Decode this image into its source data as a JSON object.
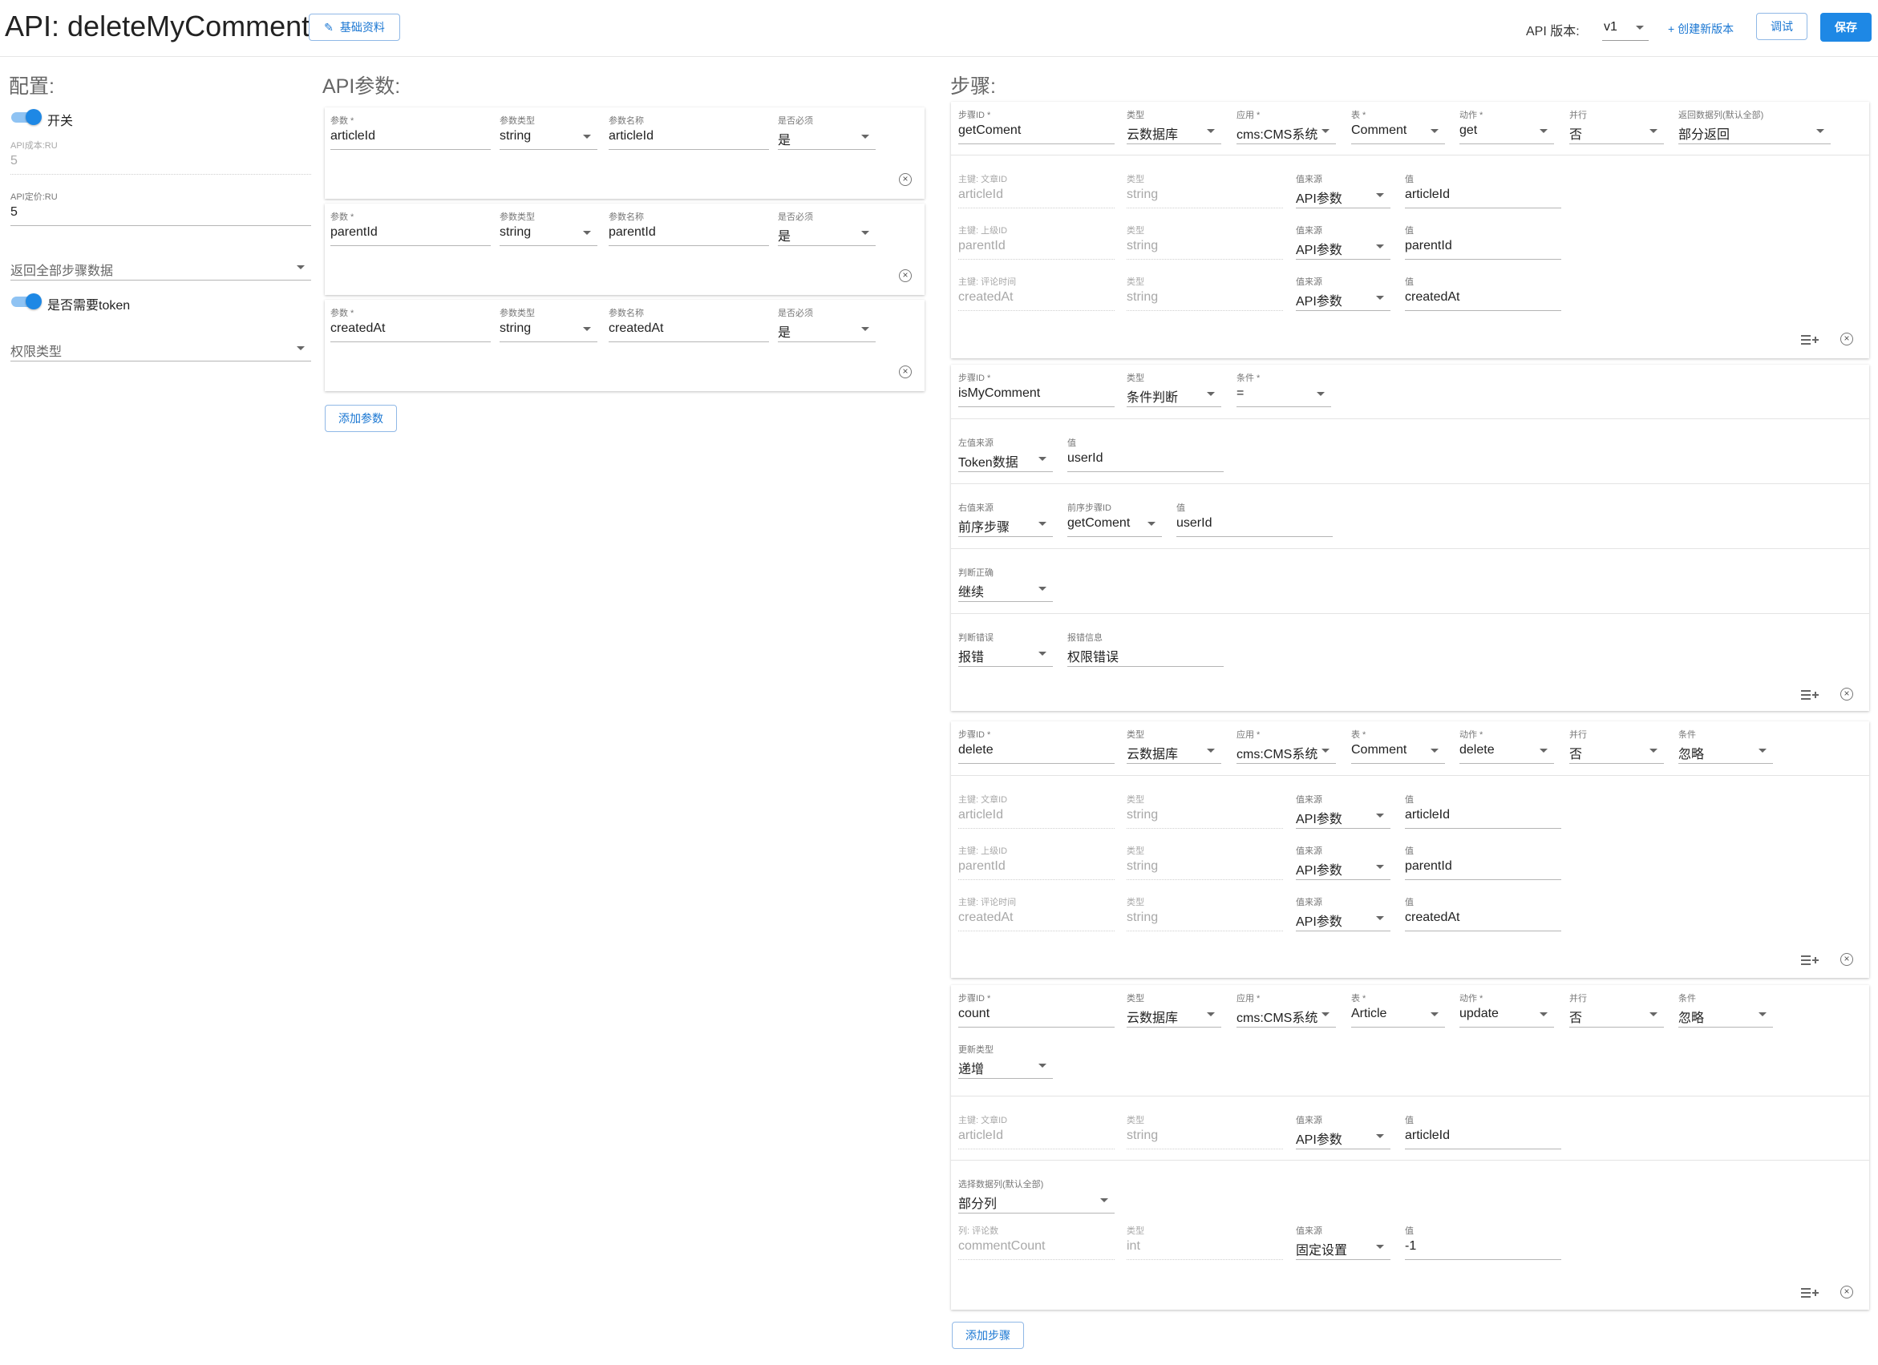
{
  "header": {
    "title": "API: deleteMyComment",
    "basic_info_label": "基础资料",
    "api_version_label": "API 版本:",
    "api_version_value": "v1",
    "create_version_label": "+ 创建新版本",
    "debug_label": "调试",
    "save_label": "保存"
  },
  "config": {
    "title": "配置:",
    "switch_label": "开关",
    "cost_label": "API成本:RU",
    "cost_value": "5",
    "price_label": "API定价:RU",
    "price_value": "5",
    "return_all_placeholder": "返回全部步骤数据",
    "need_token_label": "是否需要token",
    "permission_type_placeholder": "权限类型"
  },
  "params": {
    "title": "API参数:",
    "labels": {
      "param": "参数 *",
      "type": "参数类型",
      "name": "参数名称",
      "required": "是否必须"
    },
    "items": [
      {
        "param": "articleId",
        "type": "string",
        "name": "articleId",
        "required": "是"
      },
      {
        "param": "parentId",
        "type": "string",
        "name": "parentId",
        "required": "是"
      },
      {
        "param": "createdAt",
        "type": "string",
        "name": "createdAt",
        "required": "是"
      }
    ],
    "add_label": "添加参数"
  },
  "steps": {
    "title": "步骤:",
    "add_label": "添加步骤",
    "step1": {
      "top": [
        {
          "label": "步骤ID *",
          "value": "getComent"
        },
        {
          "label": "类型",
          "value": "云数据库"
        },
        {
          "label": "应用 *",
          "value": "cms:CMS系统"
        },
        {
          "label": "表 *",
          "value": "Comment"
        },
        {
          "label": "动作 *",
          "value": "get"
        },
        {
          "label": "并行",
          "value": "否"
        },
        {
          "label": "返回数据列(默认全部)",
          "value": "部分返回"
        }
      ],
      "keys": [
        {
          "key_label": "主键: 文章ID",
          "key": "articleId",
          "type_label": "类型",
          "type": "string",
          "src_label": "值来源",
          "src": "API参数",
          "val_label": "值",
          "val": "articleId"
        },
        {
          "key_label": "主键: 上级ID",
          "key": "parentId",
          "type_label": "类型",
          "type": "string",
          "src_label": "值来源",
          "src": "API参数",
          "val_label": "值",
          "val": "parentId"
        },
        {
          "key_label": "主键: 评论时间",
          "key": "createdAt",
          "type_label": "类型",
          "type": "string",
          "src_label": "值来源",
          "src": "API参数",
          "val_label": "值",
          "val": "createdAt"
        }
      ]
    },
    "step2": {
      "id_label": "步骤ID *",
      "id": "isMyComment",
      "type_label": "类型",
      "type": "条件判断",
      "cond_label": "条件 *",
      "cond": "=",
      "left_src_label": "左值来源",
      "left_src": "Token数据",
      "left_val_label": "值",
      "left_val": "userId",
      "right_src_label": "右值来源",
      "right_src": "前序步骤",
      "prev_step_label": "前序步骤ID",
      "prev_step": "getComent",
      "right_val_label": "值",
      "right_val": "userId",
      "true_label": "判断正确",
      "true_val": "继续",
      "false_label": "判断错误",
      "false_val": "报错",
      "err_label": "报错信息",
      "err_val": "权限错误"
    },
    "step3": {
      "top": [
        {
          "label": "步骤ID *",
          "value": "delete"
        },
        {
          "label": "类型",
          "value": "云数据库"
        },
        {
          "label": "应用 *",
          "value": "cms:CMS系统"
        },
        {
          "label": "表 *",
          "value": "Comment"
        },
        {
          "label": "动作 *",
          "value": "delete"
        },
        {
          "label": "并行",
          "value": "否"
        },
        {
          "label": "条件",
          "value": "忽略"
        }
      ],
      "keys": [
        {
          "key_label": "主键: 文章ID",
          "key": "articleId",
          "type_label": "类型",
          "type": "string",
          "src_label": "值来源",
          "src": "API参数",
          "val_label": "值",
          "val": "articleId"
        },
        {
          "key_label": "主键: 上级ID",
          "key": "parentId",
          "type_label": "类型",
          "type": "string",
          "src_label": "值来源",
          "src": "API参数",
          "val_label": "值",
          "val": "parentId"
        },
        {
          "key_label": "主键: 评论时间",
          "key": "createdAt",
          "type_label": "类型",
          "type": "string",
          "src_label": "值来源",
          "src": "API参数",
          "val_label": "值",
          "val": "createdAt"
        }
      ]
    },
    "step4": {
      "top": [
        {
          "label": "步骤ID *",
          "value": "count"
        },
        {
          "label": "类型",
          "value": "云数据库"
        },
        {
          "label": "应用 *",
          "value": "cms:CMS系统"
        },
        {
          "label": "表 *",
          "value": "Article"
        },
        {
          "label": "动作 *",
          "value": "update"
        },
        {
          "label": "并行",
          "value": "否"
        },
        {
          "label": "条件",
          "value": "忽略"
        }
      ],
      "update_type_label": "更新类型",
      "update_type": "递增",
      "key": {
        "key_label": "主键: 文章ID",
        "key": "articleId",
        "type_label": "类型",
        "type": "string",
        "src_label": "值来源",
        "src": "API参数",
        "val_label": "值",
        "val": "articleId"
      },
      "select_cols_label": "选择数据列(默认全部)",
      "select_cols": "部分列",
      "col": {
        "col_label": "列: 评论数",
        "col": "commentCount",
        "type_label": "类型",
        "type": "int",
        "src_label": "值来源",
        "src": "固定设置",
        "val_label": "值",
        "val": "-1"
      }
    }
  }
}
